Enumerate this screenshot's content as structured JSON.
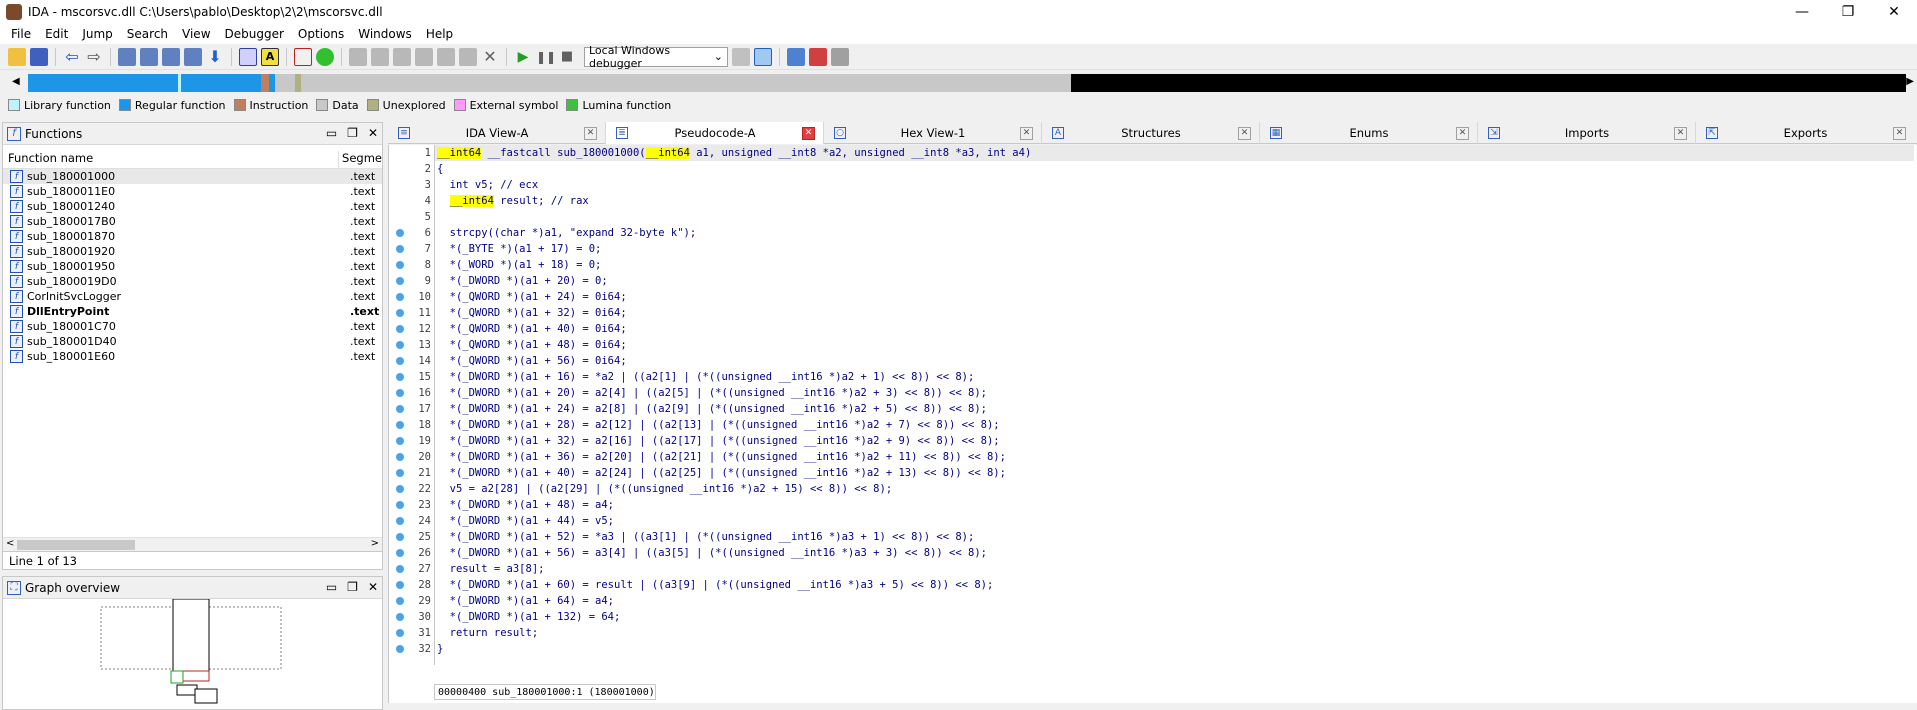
{
  "window": {
    "title": "IDA - mscorsvc.dll C:\\Users\\pablo\\Desktop\\2\\2\\mscorsvc.dll",
    "minimize": "—",
    "maximize": "❐",
    "close": "✕"
  },
  "menu": [
    "File",
    "Edit",
    "Jump",
    "Search",
    "View",
    "Debugger",
    "Options",
    "Windows",
    "Help"
  ],
  "toolbar": {
    "debugger_select": "Local Windows debugger"
  },
  "legend": [
    {
      "label": "Library function",
      "color": "#bff2ff"
    },
    {
      "label": "Regular function",
      "color": "#1e96e8"
    },
    {
      "label": "Instruction",
      "color": "#c08060"
    },
    {
      "label": "Data",
      "color": "#c8c8c8"
    },
    {
      "label": "Unexplored",
      "color": "#b0b080"
    },
    {
      "label": "External symbol",
      "color": "#ff99ff"
    },
    {
      "label": "Lumina function",
      "color": "#40c040"
    }
  ],
  "functions_panel": {
    "title": "Functions",
    "col_name": "Function name",
    "col_segment": "Segme",
    "rows": [
      {
        "name": "sub_180001000",
        "segment": ".text",
        "selected": true
      },
      {
        "name": "sub_1800011E0",
        "segment": ".text"
      },
      {
        "name": "sub_180001240",
        "segment": ".text"
      },
      {
        "name": "sub_1800017B0",
        "segment": ".text"
      },
      {
        "name": "sub_180001870",
        "segment": ".text"
      },
      {
        "name": "sub_180001920",
        "segment": ".text"
      },
      {
        "name": "sub_180001950",
        "segment": ".text"
      },
      {
        "name": "sub_1800019D0",
        "segment": ".text"
      },
      {
        "name": "CorInitSvcLogger",
        "segment": ".text"
      },
      {
        "name": "DllEntryPoint",
        "segment": ".text",
        "bold": true
      },
      {
        "name": "sub_180001C70",
        "segment": ".text"
      },
      {
        "name": "sub_180001D40",
        "segment": ".text"
      },
      {
        "name": "sub_180001E60",
        "segment": ".text"
      }
    ],
    "status": "Line 1 of 13"
  },
  "graph_panel": {
    "title": "Graph overview"
  },
  "tabs": [
    {
      "label": "IDA View-A",
      "active": false
    },
    {
      "label": "Pseudocode-A",
      "active": true
    },
    {
      "label": "Hex View-1",
      "active": false
    },
    {
      "label": "Structures",
      "active": false
    },
    {
      "label": "Enums",
      "active": false
    },
    {
      "label": "Imports",
      "active": false
    },
    {
      "label": "Exports",
      "active": false
    }
  ],
  "code": {
    "lines": [
      "__int64 __fastcall sub_180001000(__int64 a1, unsigned __int8 *a2, unsigned __int8 *a3, int a4)",
      "{",
      "  int v5; // ecx",
      "  __int64 result; // rax",
      "",
      "  strcpy((char *)a1, \"expand 32-byte k\");",
      "  *(_BYTE *)(a1 + 17) = 0;",
      "  *(_WORD *)(a1 + 18) = 0;",
      "  *(_DWORD *)(a1 + 20) = 0;",
      "  *(_QWORD *)(a1 + 24) = 0i64;",
      "  *(_QWORD *)(a1 + 32) = 0i64;",
      "  *(_QWORD *)(a1 + 40) = 0i64;",
      "  *(_QWORD *)(a1 + 48) = 0i64;",
      "  *(_QWORD *)(a1 + 56) = 0i64;",
      "  *(_DWORD *)(a1 + 16) = *a2 | ((a2[1] | (*((unsigned __int16 *)a2 + 1) << 8)) << 8);",
      "  *(_DWORD *)(a1 + 20) = a2[4] | ((a2[5] | (*((unsigned __int16 *)a2 + 3) << 8)) << 8);",
      "  *(_DWORD *)(a1 + 24) = a2[8] | ((a2[9] | (*((unsigned __int16 *)a2 + 5) << 8)) << 8);",
      "  *(_DWORD *)(a1 + 28) = a2[12] | ((a2[13] | (*((unsigned __int16 *)a2 + 7) << 8)) << 8);",
      "  *(_DWORD *)(a1 + 32) = a2[16] | ((a2[17] | (*((unsigned __int16 *)a2 + 9) << 8)) << 8);",
      "  *(_DWORD *)(a1 + 36) = a2[20] | ((a2[21] | (*((unsigned __int16 *)a2 + 11) << 8)) << 8);",
      "  *(_DWORD *)(a1 + 40) = a2[24] | ((a2[25] | (*((unsigned __int16 *)a2 + 13) << 8)) << 8);",
      "  v5 = a2[28] | ((a2[29] | (*((unsigned __int16 *)a2 + 15) << 8)) << 8);",
      "  *(_DWORD *)(a1 + 48) = a4;",
      "  *(_DWORD *)(a1 + 44) = v5;",
      "  *(_DWORD *)(a1 + 52) = *a3 | ((a3[1] | (*((unsigned __int16 *)a3 + 1) << 8)) << 8);",
      "  *(_DWORD *)(a1 + 56) = a3[4] | ((a3[5] | (*((unsigned __int16 *)a3 + 3) << 8)) << 8);",
      "  result = a3[8];",
      "  *(_DWORD *)(a1 + 60) = result | ((a3[9] | (*((unsigned __int16 *)a3 + 5) << 8)) << 8);",
      "  *(_DWORD *)(a1 + 64) = a4;",
      "  *(_DWORD *)(a1 + 132) = 64;",
      "  return result;",
      "}"
    ],
    "breakpoint_lines": [
      6,
      7,
      8,
      9,
      10,
      11,
      12,
      13,
      14,
      15,
      16,
      17,
      18,
      19,
      20,
      21,
      22,
      23,
      24,
      25,
      26,
      27,
      28,
      29,
      30,
      31,
      32
    ],
    "highlight_type": "__int64",
    "status": "00000400 sub_180001000:1 (180001000)"
  }
}
